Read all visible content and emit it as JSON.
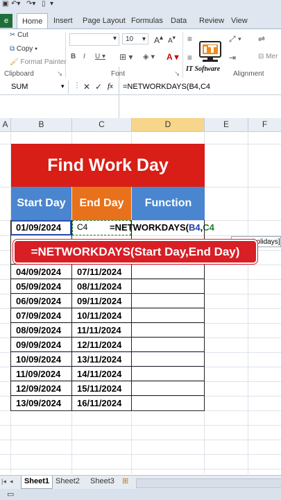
{
  "tabs": [
    "Home",
    "Insert",
    "Page Layout",
    "Formulas",
    "Data",
    "Review",
    "View"
  ],
  "ribbon": {
    "cut": "Cut",
    "copy": "Copy",
    "format_painter": "Format Painter",
    "clipboard_group": "Clipboard",
    "font_group": "Font",
    "alignment_group": "Alignment",
    "font_size": "10",
    "merge_partial": "Mer",
    "logo_text": "IT Software"
  },
  "formula_bar": {
    "name_box": "SUM",
    "fx": "fx",
    "formula": "=NETWORKDAYS(B4,C4"
  },
  "columns": [
    "A",
    "B",
    "C",
    "D",
    "E",
    "F"
  ],
  "sheet": {
    "title": "Find Work Day",
    "headers": {
      "start": "Start Day",
      "end": "End Day",
      "function": "Function"
    },
    "editing": {
      "b4": "01/09/2024",
      "c4_ref": "C4",
      "formula_prefix": "=NETWORKDAYS(",
      "formula_ref1": "B4",
      "formula_comma": ",",
      "formula_ref2": "C4"
    },
    "tooltip_tail": "holidays]",
    "banner": "=NETWORKDAYS(Start Day,End Day)",
    "rows": [
      {
        "start": "04/09/2024",
        "end": "07/11/2024"
      },
      {
        "start": "05/09/2024",
        "end": "08/11/2024"
      },
      {
        "start": "06/09/2024",
        "end": "09/11/2024"
      },
      {
        "start": "07/09/2024",
        "end": "10/11/2024"
      },
      {
        "start": "08/09/2024",
        "end": "11/11/2024"
      },
      {
        "start": "09/09/2024",
        "end": "12/11/2024"
      },
      {
        "start": "10/09/2024",
        "end": "13/11/2024"
      },
      {
        "start": "11/09/2024",
        "end": "14/11/2024"
      },
      {
        "start": "12/09/2024",
        "end": "15/11/2024"
      },
      {
        "start": "13/09/2024",
        "end": "16/11/2024"
      }
    ]
  },
  "sheet_tabs": [
    "Sheet1",
    "Sheet2",
    "Sheet3"
  ],
  "colors": {
    "title_red": "#d81e16",
    "header_blue": "#4a86cf",
    "header_orange": "#e8711b",
    "banner_red": "#d81f26",
    "excel_green": "#1f6f3a"
  }
}
